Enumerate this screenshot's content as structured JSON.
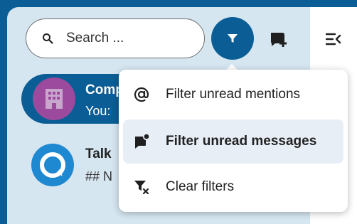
{
  "search": {
    "placeholder": "Search ..."
  },
  "header": {
    "filter_icon": "filter-icon",
    "new_conversation_icon": "chat-plus-icon",
    "toggle_icon": "menu-toggle-icon"
  },
  "conversations": [
    {
      "name": "Comp",
      "subtitle": "You:",
      "avatar": "building-icon",
      "active": true
    },
    {
      "name": "Talk",
      "subtitle": "## N",
      "avatar": "talk-logo-icon",
      "active": false
    }
  ],
  "filter_menu": {
    "items": [
      {
        "label": "Filter unread mentions",
        "icon": "at-sign-icon",
        "selected": false
      },
      {
        "label": "Filter unread messages",
        "icon": "message-badge-icon",
        "selected": true
      },
      {
        "label": "Clear filters",
        "icon": "filter-remove-icon",
        "selected": false
      }
    ]
  },
  "colors": {
    "primary": "#0b5e95",
    "sidebar": "#d6e6f1",
    "avatar_purple": "#9c4a9e",
    "avatar_blue": "#1e88d0",
    "menu_highlight": "#e8eef6"
  }
}
